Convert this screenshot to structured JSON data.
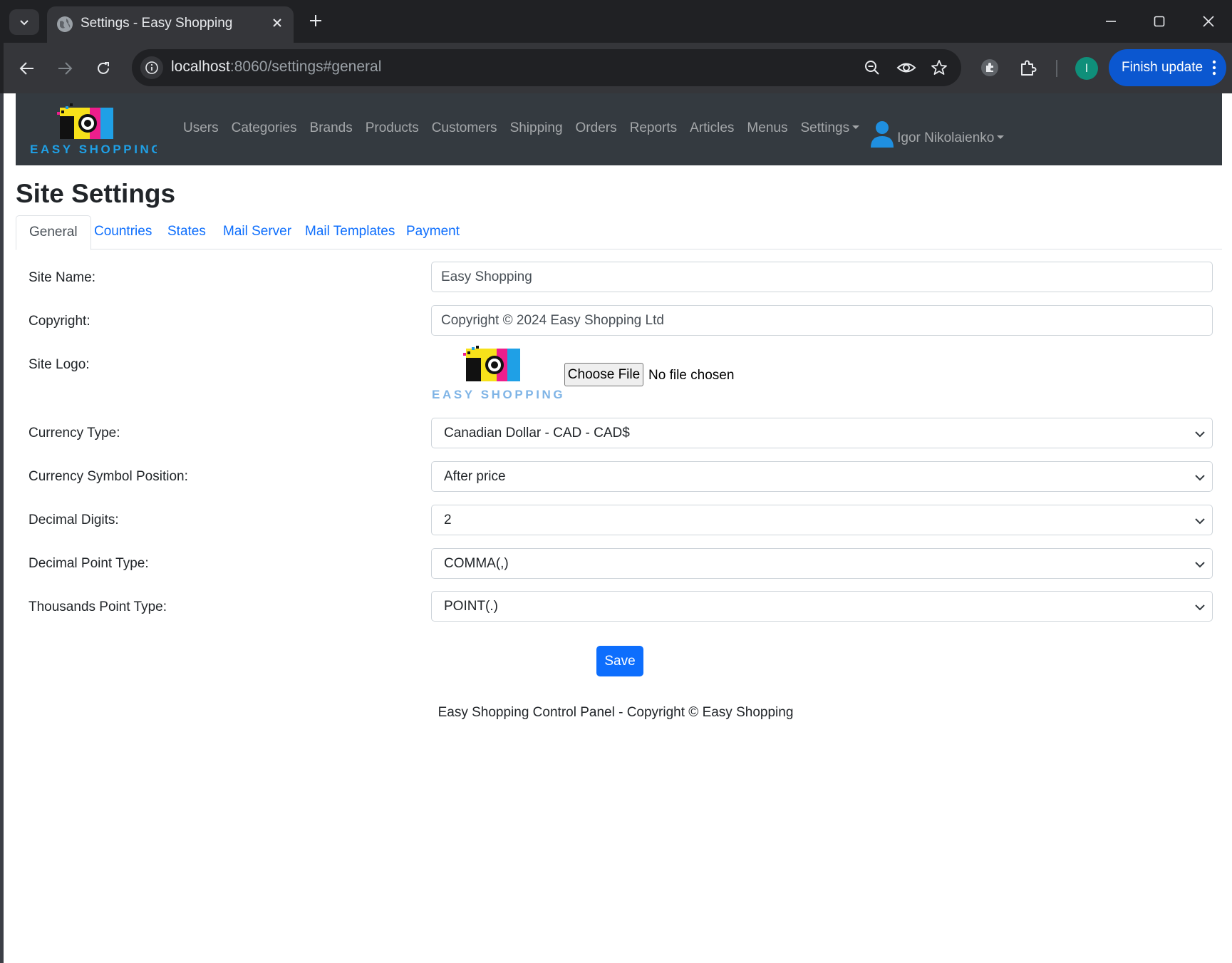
{
  "browser": {
    "tab_title": "Settings - Easy Shopping",
    "url_host": "localhost",
    "url_path": ":8060/settings#general",
    "profile_initial": "I",
    "finish_update_label": "Finish update"
  },
  "navbar": {
    "brand_text": "EASY SHOPPING",
    "links": [
      "Users",
      "Categories",
      "Brands",
      "Products",
      "Customers",
      "Shipping",
      "Orders",
      "Reports",
      "Articles",
      "Menus"
    ],
    "settings_label": "Settings",
    "user_name": "Igor Nikolaienko"
  },
  "page": {
    "title": "Site Settings",
    "tabs": [
      "General",
      "Countries",
      "States",
      "Mail Server",
      "Mail Templates",
      "Payment"
    ],
    "active_tab": "General"
  },
  "form": {
    "site_name_label": "Site Name:",
    "site_name_value": "Easy Shopping",
    "copyright_label": "Copyright:",
    "copyright_value": "Copyright © 2024 Easy Shopping Ltd",
    "site_logo_label": "Site Logo:",
    "logo_text": "EASY SHOPPING",
    "choose_file_label": "Choose File",
    "file_status": "No file chosen",
    "currency_type_label": "Currency Type:",
    "currency_type_value": "Canadian Dollar - CAD - CAD$",
    "symbol_position_label": "Currency Symbol Position:",
    "symbol_position_value": "After price",
    "decimal_digits_label": "Decimal Digits:",
    "decimal_digits_value": "2",
    "decimal_point_label": "Decimal Point Type:",
    "decimal_point_value": "COMMA(,)",
    "thousands_point_label": "Thousands Point Type:",
    "thousands_point_value": "POINT(.)",
    "save_label": "Save"
  },
  "footer": {
    "text": "Easy Shopping Control Panel - Copyright © Easy Shopping"
  },
  "colors": {
    "navbar_bg": "#343a40",
    "link_blue": "#0d6efd",
    "chrome_dark": "#202124",
    "chrome_toolbar": "#35363a",
    "update_button": "#0b57d0"
  }
}
